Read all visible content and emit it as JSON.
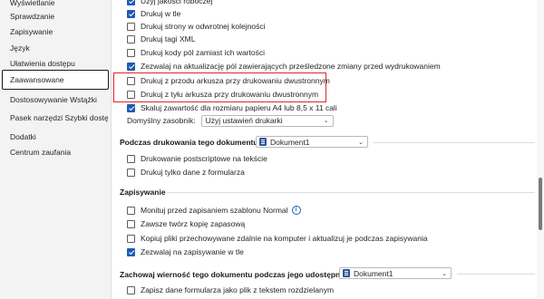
{
  "sidebar": {
    "items": [
      {
        "label": "Wyświetlanie"
      },
      {
        "label": "Sprawdzanie"
      },
      {
        "label": "Zapisywanie"
      },
      {
        "label": "Język"
      },
      {
        "label": "Ułatwienia dostępu"
      },
      {
        "label": "Zaawansowane"
      },
      {
        "label": "Dostosowywanie Wstążki"
      },
      {
        "label": "Pasek narzędzi Szybki dostęp"
      },
      {
        "label": "Dodatki"
      },
      {
        "label": "Centrum zaufania"
      }
    ],
    "selected": "Zaawansowane"
  },
  "print_options": [
    {
      "label": "Drukuj w tle",
      "checked": true
    },
    {
      "label": "Drukuj strony w odwrotnej kolejności",
      "checked": false
    },
    {
      "label": "Drukuj tagi XML",
      "checked": false
    },
    {
      "label": "Drukuj kody pól zamiast ich wartości",
      "checked": false
    },
    {
      "label": "Zezwalaj na aktualizację pól zawierających prześledzone zmiany przed wydrukowaniem",
      "checked": true
    },
    {
      "label": "Drukuj z przodu arkusza przy drukowaniu dwustronnym",
      "checked": false
    },
    {
      "label": "Drukuj z tyłu arkusza przy drukowaniu dwustronnym",
      "checked": false
    },
    {
      "label": "Skaluj zawartość dla rozmiaru papieru A4 lub 8,5 x 11 cali",
      "checked": true
    }
  ],
  "default_source": {
    "label": "Domyślny zasobnik:",
    "value": "Użyj ustawień drukarki"
  },
  "print_doc_section": {
    "title": "Podczas drukowania tego dokumentu:",
    "document": "Dokument1",
    "options": [
      {
        "label": "Drukowanie postscriptowe na tekście",
        "checked": false
      },
      {
        "label": "Drukuj tylko dane z formularza",
        "checked": false
      }
    ]
  },
  "save_section": {
    "title": "Zapisywanie",
    "options": [
      {
        "label": "Monituj przed zapisaniem szablonu Normal",
        "checked": false,
        "info": true
      },
      {
        "label": "Zawsze twórz kopię zapasową",
        "checked": false
      },
      {
        "label": "Kopiuj pliki przechowywane zdalnie na komputer i aktualizuj je podczas zapisywania",
        "checked": false
      },
      {
        "label": "Zezwalaj na zapisywanie w tle",
        "checked": true
      }
    ]
  },
  "fidelity_section": {
    "title": "Zachowaj wierność tego dokumentu podczas jego udostępniania:",
    "document": "Dokument1",
    "options": [
      {
        "label": "Zapisz dane formularza jako plik z tekstem rozdzielanym",
        "checked": false
      }
    ]
  },
  "info_icon_glyph": "i",
  "chevron_glyph": "⌄",
  "highlight_color": "#e0262b",
  "accent_color": "#1d5bb5"
}
